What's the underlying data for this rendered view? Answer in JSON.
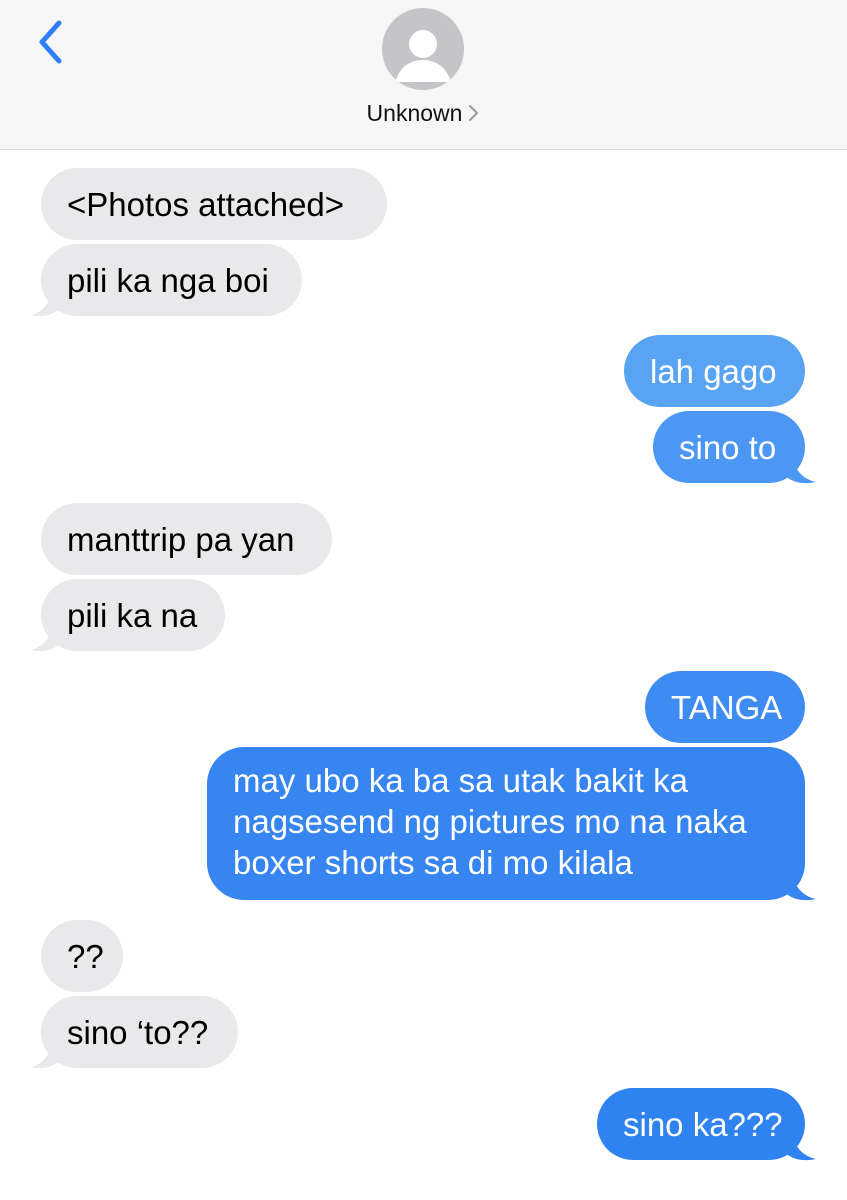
{
  "header": {
    "contact_name": "Unknown",
    "icons": {
      "back": "chevron-left-icon",
      "avatar": "person-silhouette-icon",
      "disclosure": "chevron-right-icon"
    }
  },
  "colors": {
    "incoming_bubble": "#e9e9eb",
    "outgoing_bubble": "#2e80f0",
    "accent": "#2f7ef6"
  },
  "messages": [
    {
      "direction": "incoming",
      "text": "<Photos attached>"
    },
    {
      "direction": "incoming",
      "text": "pili ka nga boi"
    },
    {
      "direction": "outgoing",
      "text": "lah gago"
    },
    {
      "direction": "outgoing",
      "text": "sino to"
    },
    {
      "direction": "incoming",
      "text": "manttrip pa yan"
    },
    {
      "direction": "incoming",
      "text": "pili ka na"
    },
    {
      "direction": "outgoing",
      "text": "TANGA"
    },
    {
      "direction": "outgoing",
      "text": "may ubo ka ba sa utak bakit ka nagsesend ng pictures mo na naka boxer shorts sa di mo kilala"
    },
    {
      "direction": "incoming",
      "text": "??"
    },
    {
      "direction": "incoming",
      "text": "sino ‘to??"
    },
    {
      "direction": "outgoing",
      "text": "sino ka???"
    }
  ]
}
